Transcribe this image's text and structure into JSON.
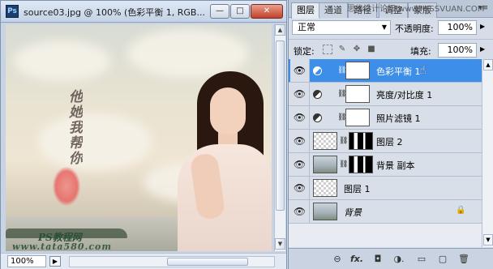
{
  "document": {
    "app_icon": "Ps",
    "title": "source03.jpg @ 100% (色彩平衡 1, RGB...",
    "min_icon": "minimize-icon",
    "max_icon": "maximize-icon",
    "close_icon": "close-icon",
    "min_glyph": "—",
    "max_glyph": "□",
    "close_glyph": "✕",
    "canvas": {
      "calligraphy": "他她我帮你",
      "watermark_line1": "PS教程网",
      "watermark_line2": "www.tata580.com"
    },
    "status": {
      "zoom": "100%"
    }
  },
  "panel": {
    "watermark_top": "思缘设计论坛  www.MISSVUAN.COM",
    "tabs": [
      {
        "label": "图层",
        "active": true
      },
      {
        "label": "通道",
        "active": false
      },
      {
        "label": "路径",
        "active": false
      },
      {
        "label": "调整",
        "active": false
      },
      {
        "label": "蒙版",
        "active": false
      }
    ],
    "blend_mode": "正常",
    "opacity_label": "不透明度:",
    "opacity_value": "100%",
    "lock_label": "锁定:",
    "fill_label": "填充:",
    "fill_value": "100%",
    "layers": [
      {
        "name": "色彩平衡 1",
        "type": "adjustment",
        "selected": true
      },
      {
        "name": "亮度/对比度 1",
        "type": "adjustment",
        "selected": false
      },
      {
        "name": "照片滤镜 1",
        "type": "adjustment",
        "selected": false
      },
      {
        "name": "图层 2",
        "type": "masked",
        "selected": false
      },
      {
        "name": "背景 副本",
        "type": "masked-photo",
        "selected": false
      },
      {
        "name": "图层 1",
        "type": "transparent",
        "selected": false
      },
      {
        "name": "背景",
        "type": "background",
        "selected": false,
        "locked": true
      }
    ],
    "bottom_icons": [
      "link-icon",
      "fx-icon",
      "add-mask-icon",
      "adjustment-icon",
      "group-icon",
      "new-layer-icon",
      "delete-icon"
    ],
    "bottom_glyphs": [
      "⊖",
      "fx.",
      "◘",
      "◑.",
      "▭",
      "▢",
      "🗑"
    ]
  }
}
